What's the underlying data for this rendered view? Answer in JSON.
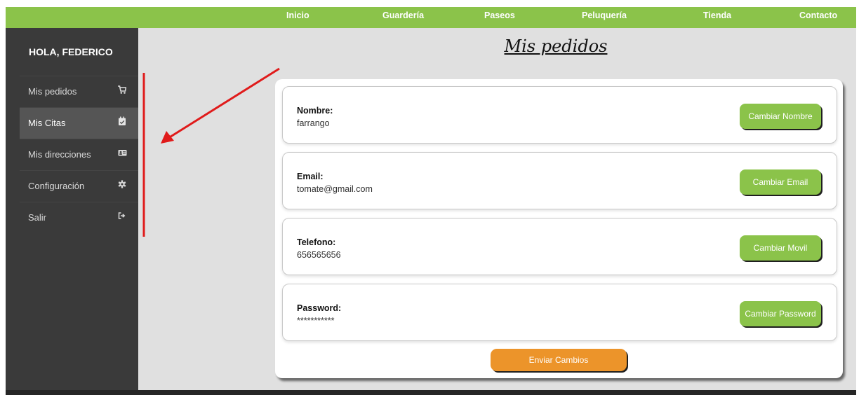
{
  "nav": {
    "items": [
      {
        "label": "Inicio"
      },
      {
        "label": "Guardería"
      },
      {
        "label": "Paseos"
      },
      {
        "label": "Peluquería"
      },
      {
        "label": "Tienda"
      },
      {
        "label": "Contacto"
      }
    ]
  },
  "sidebar": {
    "greeting": "HOLA, FEDERICO",
    "items": [
      {
        "label": "Mis pedidos",
        "icon": "cart-icon"
      },
      {
        "label": "Mis Citas",
        "icon": "calendar-check-icon",
        "active": true
      },
      {
        "label": "Mis direcciones",
        "icon": "address-card-icon"
      },
      {
        "label": "Configuración",
        "icon": "gear-icon"
      },
      {
        "label": "Salir",
        "icon": "sign-out-icon"
      }
    ]
  },
  "main": {
    "title": "Mis pedidos",
    "fields": [
      {
        "label": "Nombre:",
        "value": "farrango",
        "button": "Cambiar Nombre"
      },
      {
        "label": "Email:",
        "value": "tomate@gmail.com",
        "button": "Cambiar Email"
      },
      {
        "label": "Telefono:",
        "value": "656565656",
        "button": "Cambiar Movil"
      },
      {
        "label": "Password:",
        "value": "***********",
        "button": "Cambiar Password"
      }
    ],
    "submit": "Enviar Cambios"
  },
  "colors": {
    "nav_green": "#8bc34a",
    "sidebar_dark": "#3a3a3a",
    "active_item": "#555555",
    "submit_orange": "#ec942a",
    "annotation_red": "#e01b1b"
  }
}
